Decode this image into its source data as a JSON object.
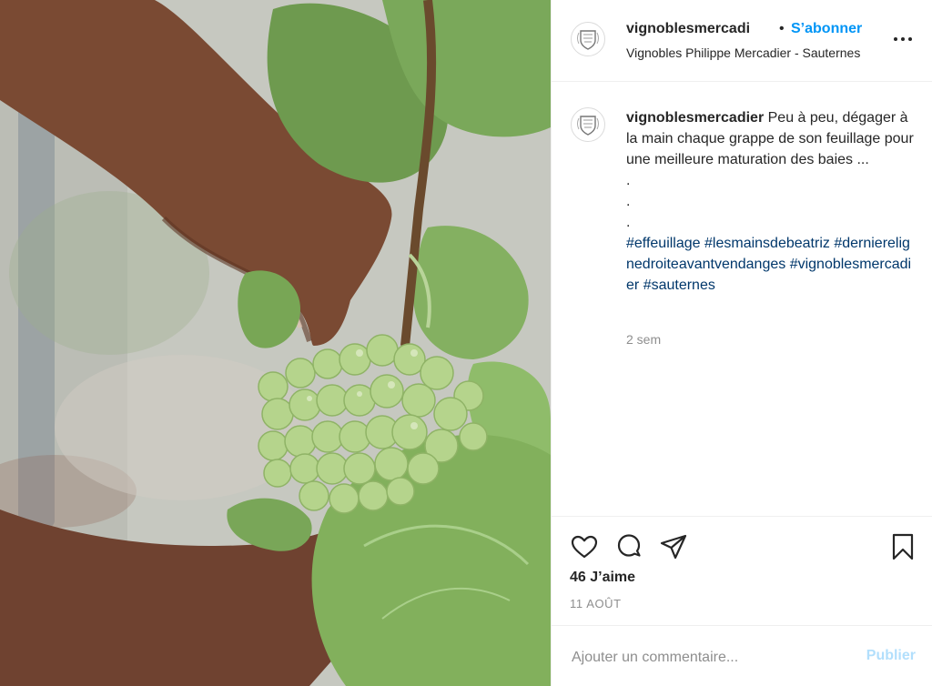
{
  "post": {
    "image": {
      "alt_icon": "grape-photo"
    },
    "header": {
      "username": "vignoblesmercadi",
      "separator": "•",
      "follow_label": "S’abonner",
      "location": "Vignobles Philippe Mercadier - Sauternes",
      "more_icon": "more-horizontal-icon"
    },
    "caption": {
      "username": "vignoblesmercadier",
      "text": "Peu à peu, dégager à la main chaque grappe de son feuillage pour une meilleure maturation des baies ...",
      "dots": [
        ".",
        ".",
        "."
      ],
      "hashtags": [
        "#effeuillage",
        "#lesmainsdebeatriz",
        "#dernierelignedroiteavantvendanges",
        "#vignoblesmercadier",
        "#sauternes"
      ],
      "time_ago": "2 sem"
    },
    "actions": {
      "like_icon": "heart-icon",
      "comment_icon": "comment-icon",
      "share_icon": "share-icon",
      "save_icon": "bookmark-icon",
      "likes": "46 J’aime",
      "date": "11 AOÛT"
    },
    "comment_box": {
      "placeholder": "Ajouter un commentaire...",
      "publish_label": "Publier"
    },
    "colors": {
      "link": "#00376b",
      "accent": "#0095f6",
      "publish_disabled": "#b2dffc",
      "muted": "#8e8e8e"
    }
  }
}
